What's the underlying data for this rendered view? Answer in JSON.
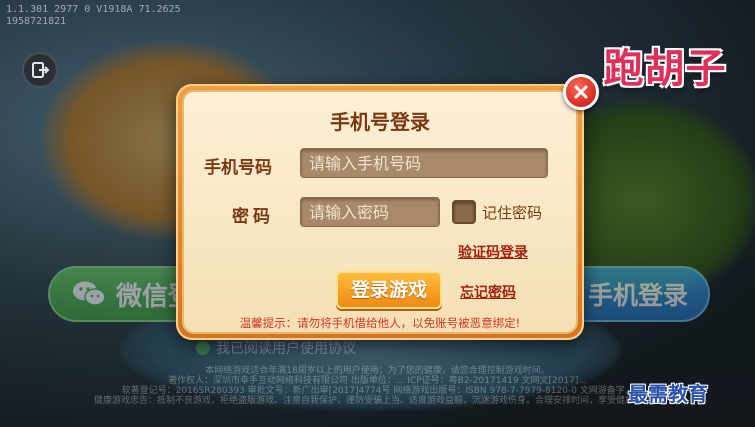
{
  "version_info": {
    "line1": "1.1.301 2977 0 V1918A 71.2625",
    "line2": "1958721821"
  },
  "game_logo": {
    "text": "跑胡子"
  },
  "background_buttons": {
    "wechat_login": "微信登",
    "phone_login": "手机登录",
    "agreement": "我已阅读用户使用协议"
  },
  "footer": {
    "line1": "本网络游戏适合年满18周岁以上的用户使用；为了您的健康，请您合理控制游戏时间。",
    "line2": "著作权人：深圳市幸手互动网络科技有限公司 出版单位：... ICP证号：粤B2-20171419 文网文[2017]...",
    "line3": "软著登记号：2016SR280393 审批文号：新广出审[2017]4774号 网络游戏出版号：ISBN 978-7-7979-8120-0 文网游备字...",
    "line4": "健康游戏忠告：抵制不良游戏，拒绝盗版游戏。注意自我保护，谨防受骗上当。适度游戏益脑，沉迷游戏伤身。合理安排时间，享受健康生活。"
  },
  "dialog": {
    "title": "手机号登录",
    "phone_label": "手机号码",
    "phone_placeholder": "请输入手机号码",
    "password_label": "密码",
    "password_placeholder": "请输入密码",
    "remember_label": "记住密码",
    "code_login_link": "验证码登录",
    "login_button": "登录游戏",
    "forgot_link": "忘记密码",
    "tip": "温馨提示：请勿将手机借给他人，以免账号被恶意绑定!"
  },
  "watermark": "最需教育",
  "colors": {
    "dialog_frame": "#e88a2a",
    "dialog_body": "#fbe9c8",
    "title_text": "#7a3a12",
    "tip_text": "#d0382a",
    "login_button": "#f5a020",
    "close_button": "#d42a20"
  },
  "icons": [
    "exit-icon",
    "close-icon",
    "wechat-icon",
    "checkbox-icon"
  ]
}
